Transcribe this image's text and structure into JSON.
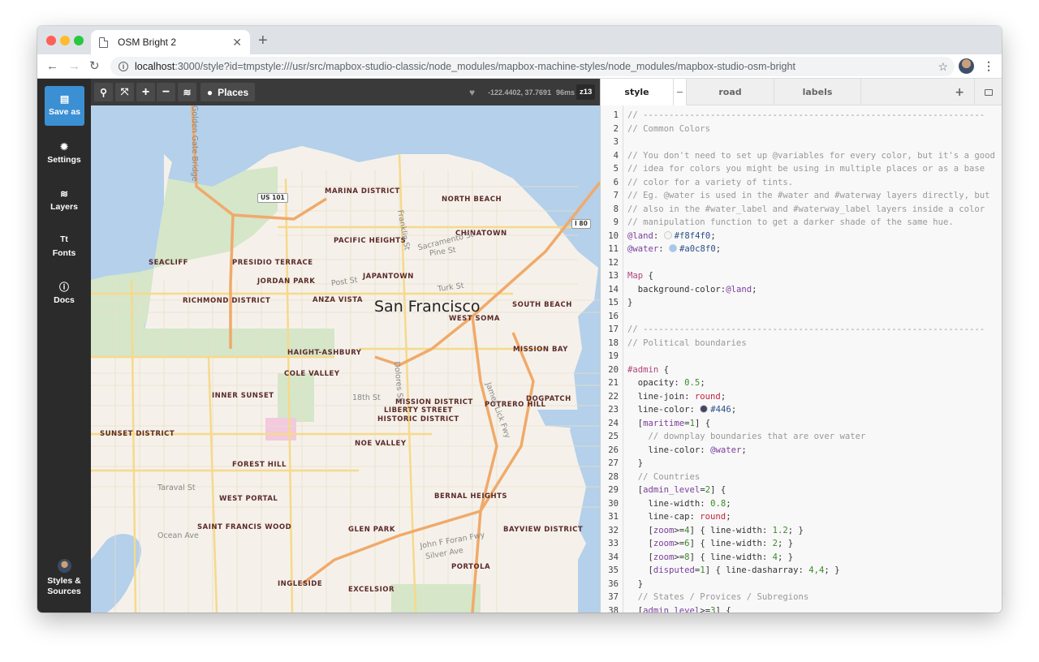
{
  "browser": {
    "tab_title": "OSM Bright 2",
    "url_host": "localhost",
    "url_path": ":3000/style?id=tmpstyle:///usr/src/mapbox-studio-classic/node_modules/mapbox-machine-styles/node_modules/mapbox-studio-osm-bright"
  },
  "sidebar": {
    "items": [
      {
        "label": "Save as",
        "icon": "save-icon"
      },
      {
        "label": "Settings",
        "icon": "gear-icon"
      },
      {
        "label": "Layers",
        "icon": "layers-icon"
      },
      {
        "label": "Fonts",
        "icon": "fonts-icon"
      },
      {
        "label": "Docs",
        "icon": "info-icon"
      }
    ],
    "bottom": {
      "label_line1": "Styles &",
      "label_line2": "Sources",
      "icon": "avatar"
    }
  },
  "mapbar": {
    "places_label": "Places",
    "coords": "-122.4402, 37.7691",
    "render_time": "96ms",
    "zoom": "z13"
  },
  "map": {
    "city": "San Francisco",
    "districts": [
      {
        "name": "MARINA DISTRICT"
      },
      {
        "name": "NORTH BEACH"
      },
      {
        "name": "CHINATOWN"
      },
      {
        "name": "PACIFIC HEIGHTS"
      },
      {
        "name": "SEACLIFF"
      },
      {
        "name": "PRESIDIO TERRACE"
      },
      {
        "name": "JORDAN PARK"
      },
      {
        "name": "JAPANTOWN"
      },
      {
        "name": "RICHMOND DISTRICT"
      },
      {
        "name": "ANZA VISTA"
      },
      {
        "name": "SOUTH BEACH"
      },
      {
        "name": "WEST SOMA"
      },
      {
        "name": "MISSION BAY"
      },
      {
        "name": "HAIGHT-ASHBURY"
      },
      {
        "name": "COLE VALLEY"
      },
      {
        "name": "INNER SUNSET"
      },
      {
        "name": "MISSION DISTRICT"
      },
      {
        "name": "LIBERTY STREET"
      },
      {
        "name": "HISTORIC DISTRICT"
      },
      {
        "name": "POTRERO HILL"
      },
      {
        "name": "DOGPATCH"
      },
      {
        "name": "SUNSET DISTRICT"
      },
      {
        "name": "NOE VALLEY"
      },
      {
        "name": "FOREST HILL"
      },
      {
        "name": "WEST PORTAL"
      },
      {
        "name": "BERNAL HEIGHTS"
      },
      {
        "name": "SAINT FRANCIS WOOD"
      },
      {
        "name": "GLEN PARK"
      },
      {
        "name": "BAYVIEW DISTRICT"
      },
      {
        "name": "PORTOLA"
      },
      {
        "name": "INGLESIDE"
      },
      {
        "name": "EXCELSIOR"
      }
    ],
    "streets": [
      {
        "name": "Golden Gate Bridge"
      },
      {
        "name": "Franklin St"
      },
      {
        "name": "Sacramento St"
      },
      {
        "name": "Pine St"
      },
      {
        "name": "Post St"
      },
      {
        "name": "Turk St"
      },
      {
        "name": "Dolores St"
      },
      {
        "name": "18th St"
      },
      {
        "name": "James Lick Fwy"
      },
      {
        "name": "Taraval St"
      },
      {
        "name": "Ocean Ave"
      },
      {
        "name": "John F Foran Fwy"
      },
      {
        "name": "Silver Ave"
      }
    ],
    "shields": [
      {
        "name": "US 101"
      },
      {
        "name": "I 80"
      }
    ],
    "colors": {
      "land": "#f5f1ea",
      "water": "#b4d0ea",
      "park": "#d5e6c9",
      "road": "#f6d98c",
      "highway": "#f0aa6a"
    }
  },
  "editor": {
    "tabs": [
      {
        "label": "style",
        "active": true
      },
      {
        "label": "road",
        "active": false
      },
      {
        "label": "labels",
        "active": false
      }
    ],
    "collapse_label": "−",
    "add_label": "+",
    "lines": [
      {
        "n": "1",
        "html": "<span class='c-comment'>// ------------------------------------------------------------------</span>"
      },
      {
        "n": "2",
        "html": "<span class='c-comment'>// Common Colors</span>"
      },
      {
        "n": "3",
        "html": ""
      },
      {
        "n": "4",
        "html": "<span class='c-comment'>// You don't need to set up @variables for every color, but it's a good</span>"
      },
      {
        "n": "5",
        "html": "<span class='c-comment'>// idea for colors you might be using in multiple places or as a base</span>"
      },
      {
        "n": "6",
        "html": "<span class='c-comment'>// color for a variety of tints.</span>"
      },
      {
        "n": "7",
        "html": "<span class='c-comment'>// Eg. @water is used in the #water and #waterway layers directly, but</span>"
      },
      {
        "n": "8",
        "html": "<span class='c-comment'>// also in the #water_label and #waterway_label layers inside a color</span>"
      },
      {
        "n": "9",
        "html": "<span class='c-comment'>// manipulation function to get a darker shade of the same hue.</span>"
      },
      {
        "n": "10",
        "html": "<span class='c-var'>@land</span>: <span class='swatch' style='background:#f8f4f0'></span><span class='c-hex'>#f8f4f0</span>;"
      },
      {
        "n": "11",
        "html": "<span class='c-var'>@water</span>: <span class='swatch' style='background:#a0c8f0'></span><span class='c-hex'>#a0c8f0</span>;"
      },
      {
        "n": "12",
        "html": ""
      },
      {
        "n": "13",
        "html": "<span class='c-sel'>Map</span> {"
      },
      {
        "n": "14",
        "html": "  background-color:<span class='c-var'>@land</span>;"
      },
      {
        "n": "15",
        "html": "}"
      },
      {
        "n": "16",
        "html": ""
      },
      {
        "n": "17",
        "html": "<span class='c-comment'>// ------------------------------------------------------------------</span>"
      },
      {
        "n": "18",
        "html": "<span class='c-comment'>// Political boundaries</span>"
      },
      {
        "n": "19",
        "html": ""
      },
      {
        "n": "20",
        "html": "<span class='c-sel'>#admin</span> {"
      },
      {
        "n": "21",
        "html": "  opacity: <span class='c-num'>0.5</span>;"
      },
      {
        "n": "22",
        "html": "  line-join: <span class='c-kw'>round</span>;"
      },
      {
        "n": "23",
        "html": "  line-color: <span class='swatch' style='background:#444466'></span><span class='c-hex'>#446</span>;"
      },
      {
        "n": "24",
        "html": "  [<span class='c-var'>maritime</span>=<span class='c-num'>1</span>] {"
      },
      {
        "n": "25",
        "html": "    <span class='c-comment'>// downplay boundaries that are over water</span>"
      },
      {
        "n": "26",
        "html": "    line-color: <span class='c-var'>@water</span>;"
      },
      {
        "n": "27",
        "html": "  }"
      },
      {
        "n": "28",
        "html": "  <span class='c-comment'>// Countries</span>"
      },
      {
        "n": "29",
        "html": "  [<span class='c-var'>admin_level</span>=<span class='c-num'>2</span>] {"
      },
      {
        "n": "30",
        "html": "    line-width: <span class='c-num'>0.8</span>;"
      },
      {
        "n": "31",
        "html": "    line-cap: <span class='c-kw'>round</span>;"
      },
      {
        "n": "32",
        "html": "    [<span class='c-var'>zoom</span>&gt;=<span class='c-num'>4</span>] { line-width: <span class='c-num'>1.2</span>; }"
      },
      {
        "n": "33",
        "html": "    [<span class='c-var'>zoom</span>&gt;=<span class='c-num'>6</span>] { line-width: <span class='c-num'>2</span>; }"
      },
      {
        "n": "34",
        "html": "    [<span class='c-var'>zoom</span>&gt;=<span class='c-num'>8</span>] { line-width: <span class='c-num'>4</span>; }"
      },
      {
        "n": "35",
        "html": "    [<span class='c-var'>disputed</span>=<span class='c-num'>1</span>] { line-dasharray: <span class='c-num'>4,4</span>; }"
      },
      {
        "n": "36",
        "html": "  }"
      },
      {
        "n": "37",
        "html": "  <span class='c-comment'>// States / Provices / Subregions</span>"
      },
      {
        "n": "38",
        "html": "  [<span class='c-var'>admin_level</span>&gt;=<span class='c-num'>3</span>] {"
      }
    ]
  }
}
